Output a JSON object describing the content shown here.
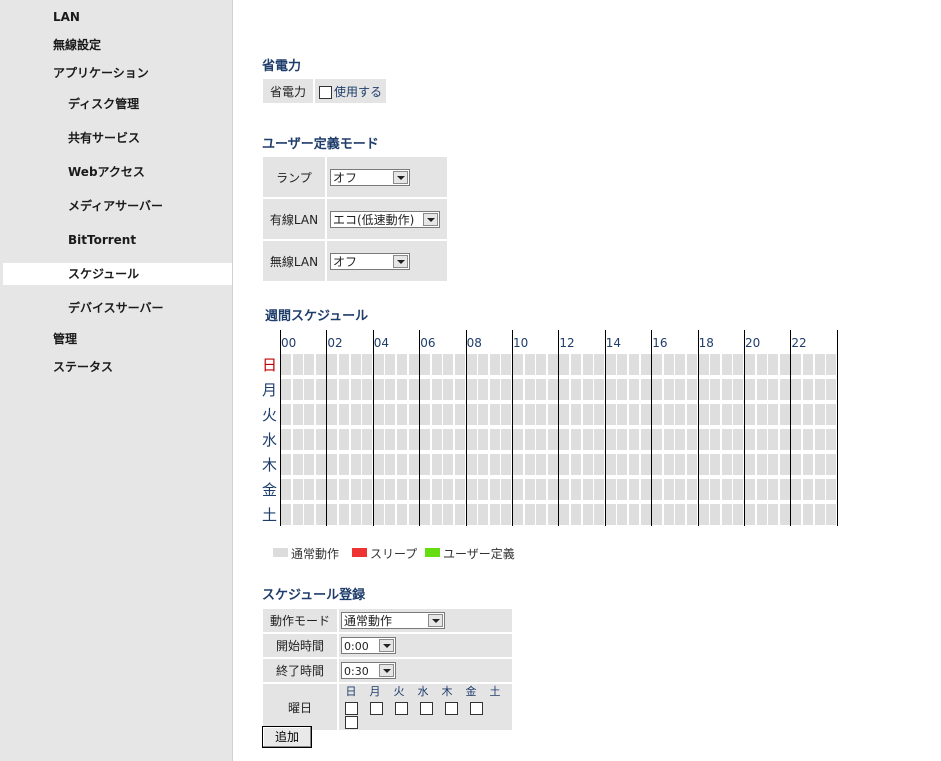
{
  "sidebar": {
    "items": [
      {
        "label": "LAN"
      },
      {
        "label": "無線設定"
      },
      {
        "label": "アプリケーション"
      },
      {
        "label": "ディスク管理"
      },
      {
        "label": "共有サービス"
      },
      {
        "label": "Webアクセス"
      },
      {
        "label": "メディアサーバー"
      },
      {
        "label": "BitTorrent"
      },
      {
        "label": "スケジュール"
      },
      {
        "label": "デバイスサーバー"
      },
      {
        "label": "管理"
      },
      {
        "label": "ステータス"
      }
    ]
  },
  "power_saving": {
    "title": "省電力",
    "row_label": "省電力",
    "checkbox_label": "使用する"
  },
  "user_mode": {
    "title": "ユーザー定義モード",
    "rows": [
      {
        "label": "ランプ",
        "value": "オフ"
      },
      {
        "label": "有線LAN",
        "value": "エコ(低速動作)"
      },
      {
        "label": "無線LAN",
        "value": "オフ"
      }
    ]
  },
  "weekly": {
    "title": "週間スケジュール",
    "hours": [
      "00",
      "02",
      "04",
      "06",
      "08",
      "10",
      "12",
      "14",
      "16",
      "18",
      "20",
      "22"
    ],
    "days": [
      "日",
      "月",
      "火",
      "水",
      "木",
      "金",
      "土"
    ]
  },
  "legend": [
    {
      "label": "通常動作",
      "color": "#dcdcdc"
    },
    {
      "label": "スリープ",
      "color": "#ee3333"
    },
    {
      "label": "ユーザー定義",
      "color": "#66dd11"
    }
  ],
  "register": {
    "title": "スケジュール登録",
    "mode_label": "動作モード",
    "mode_value": "通常動作",
    "start_label": "開始時間",
    "start_value": "0:00",
    "end_label": "終了時間",
    "end_value": "0:30",
    "dow_label": "曜日",
    "dow": [
      "日",
      "月",
      "火",
      "水",
      "木",
      "金",
      "土"
    ],
    "add_button": "追加"
  }
}
